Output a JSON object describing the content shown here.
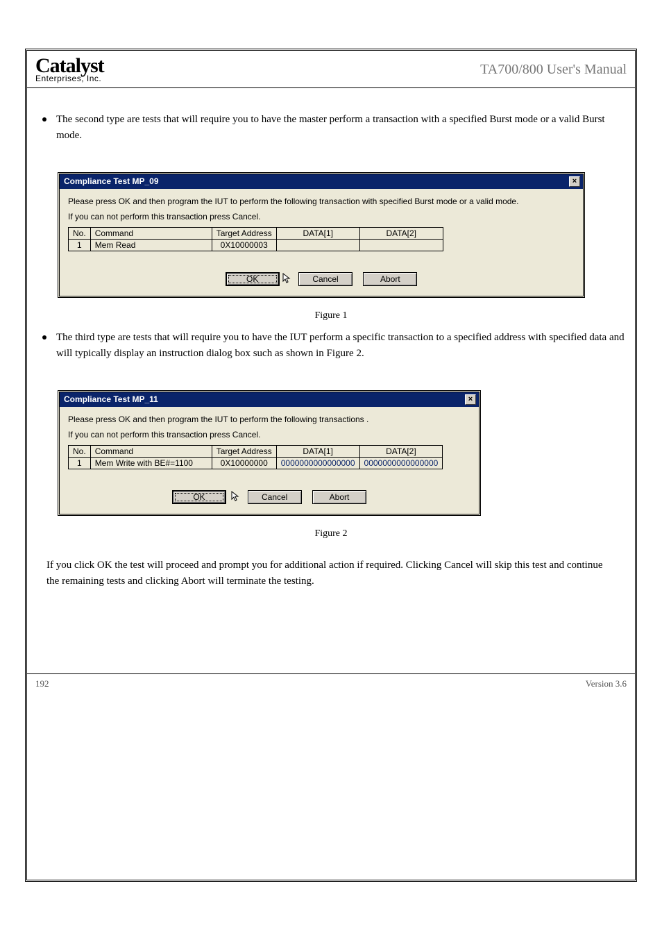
{
  "header": {
    "logo_main": "Catalyst",
    "logo_sub": "Enterprises, Inc.",
    "doc_title": "TA700/800 User's Manual"
  },
  "bullets": [
    "The second type are tests that will require you to have the master perform a transaction with a specified Burst mode or a valid Burst mode.",
    "The third type are tests that will require you to have the IUT perform a specific transaction to a specified address with specified data and will typically display an instruction dialog box such as shown in Figure 2."
  ],
  "dialog1": {
    "title": "Compliance Test MP_09",
    "msg_line1": "Please press OK and then program the IUT to perform the following transaction with specified Burst mode or a valid mode.",
    "msg_line2": "If you can not perform this transaction press Cancel.",
    "headers": {
      "no": "No.",
      "command": "Command",
      "target": "Target Address",
      "d1": "DATA[1]",
      "d2": "DATA[2]"
    },
    "row": {
      "no": "1",
      "command": "Mem Read",
      "target": "0X10000003",
      "d1": "",
      "d2": ""
    },
    "buttons": {
      "ok": "OK",
      "cancel": "Cancel",
      "abort": "Abort"
    }
  },
  "fig1_label": "Figure 1",
  "dialog2": {
    "title": "Compliance Test MP_11",
    "msg_line1": "Please press OK and then program the IUT to perform the following transactions .",
    "msg_line2": "If you can not perform this transaction press Cancel.",
    "headers": {
      "no": "No.",
      "command": "Command",
      "target": "Target Address",
      "d1": "DATA[1]",
      "d2": "DATA[2]"
    },
    "row": {
      "no": "1",
      "command": "Mem Write with BE#=1100",
      "target": "0X10000000",
      "d1": "0000000000000000",
      "d2": "0000000000000000"
    },
    "buttons": {
      "ok": "OK",
      "cancel": "Cancel",
      "abort": "Abort"
    }
  },
  "fig2_label": "Figure 2",
  "last_paragraph": "If you click OK the test will proceed and prompt you for additional action if required. Clicking Cancel will skip this test and continue the remaining tests and clicking Abort will terminate the testing.",
  "footer": {
    "page": "192",
    "ver": "Version 3.6"
  }
}
